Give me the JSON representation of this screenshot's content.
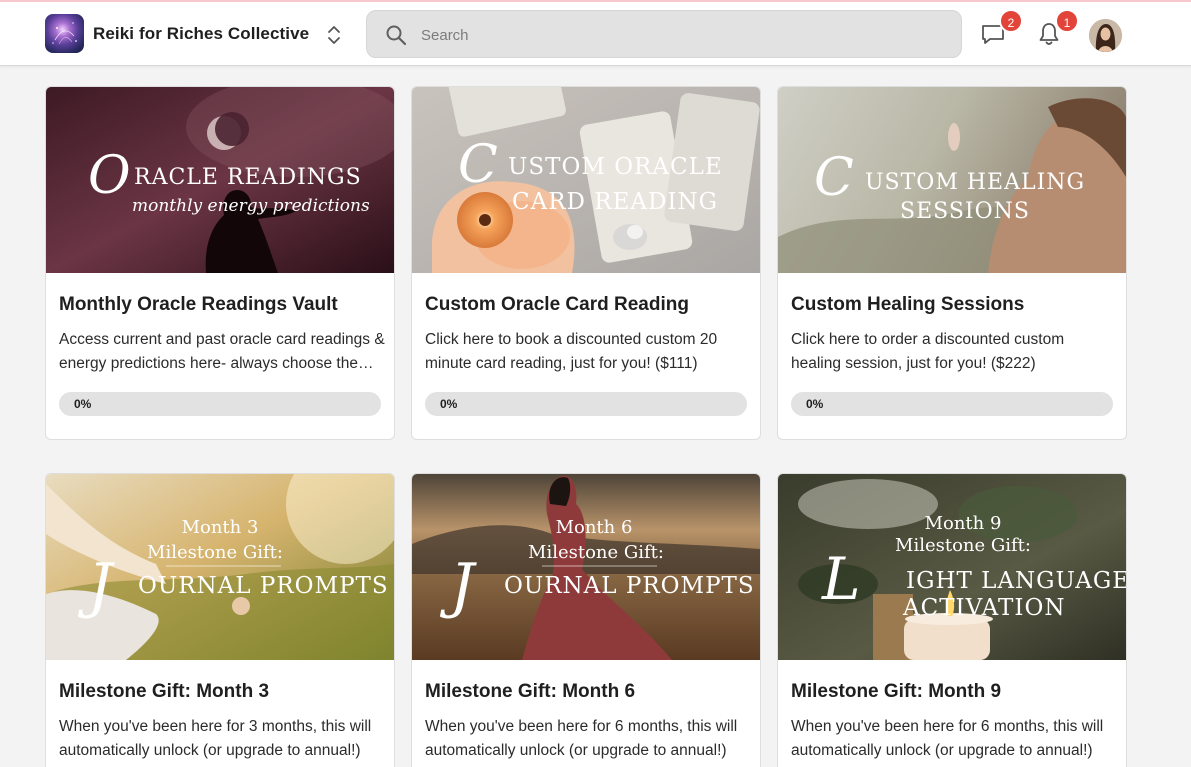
{
  "header": {
    "community_name": "Reiki for Riches Collective",
    "search_placeholder": "Search",
    "messages_badge": "2",
    "notifications_badge": "1"
  },
  "cards": [
    {
      "title": "Monthly Oracle Readings Vault",
      "description": "Access current and past oracle card readings & energy predictions here- always choose the reading that calls to you!",
      "progress_label": "0%",
      "progress": 0,
      "image_text": {
        "initial": "O",
        "line1": "RACLE READINGS",
        "line2": "monthly energy predictions"
      }
    },
    {
      "title": "Custom Oracle Card Reading",
      "description": "Click here to book a discounted custom 20 minute card reading, just for you! ($111)",
      "progress_label": "0%",
      "progress": 0,
      "image_text": {
        "initial": "C",
        "line1": "USTOM ORACLE",
        "line2": "CARD READING"
      }
    },
    {
      "title": "Custom Healing Sessions",
      "description": "Click here to order a discounted custom healing session, just for you! ($222)",
      "progress_label": "0%",
      "progress": 0,
      "image_text": {
        "initial": "C",
        "line1": "USTOM HEALING",
        "line2": "SESSIONS"
      }
    },
    {
      "title": "Milestone Gift: Month 3",
      "description": "When you've been here for 3 months, this will automatically unlock (or upgrade to annual!)",
      "image_text": {
        "top1": "Month 3",
        "top2": "Milestone Gift:",
        "initial": "J",
        "line1": "OURNAL PROMPTS"
      }
    },
    {
      "title": "Milestone Gift: Month 6",
      "description": "When you've been here for 6 months, this will automatically unlock (or upgrade to annual!)",
      "image_text": {
        "top1": "Month 6",
        "top2": "Milestone Gift:",
        "initial": "J",
        "line1": "OURNAL PROMPTS"
      }
    },
    {
      "title": "Milestone Gift: Month 9",
      "description": "When you've been here for 6 months, this will automatically unlock (or upgrade to annual!)",
      "image_text": {
        "top1": "Month 9",
        "top2": "Milestone Gift:",
        "initial": "L",
        "line1": "IGHT LANGUAGE",
        "line2": "ACTIVATION"
      }
    }
  ],
  "colors": {
    "badge": "#e2443a",
    "progress_track": "#e2e2e2",
    "search_bg": "#e2e2e2"
  },
  "icons": [
    "switcher-icon",
    "search-icon",
    "chat-bubble-icon",
    "bell-icon"
  ]
}
